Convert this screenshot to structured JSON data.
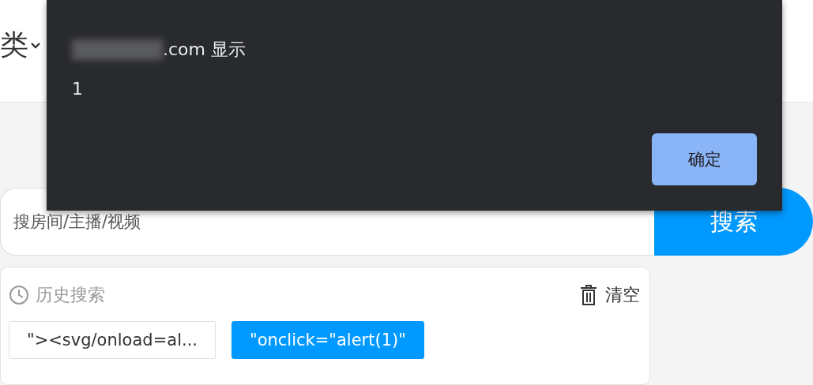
{
  "header": {
    "category_label": "类"
  },
  "search": {
    "placeholder": "搜房间/主播/视频",
    "button": "搜索"
  },
  "history": {
    "title": "历史搜索",
    "clear": "清空",
    "tags": [
      {
        "label": "\"><svg/onload=al...",
        "selected": false
      },
      {
        "label": "\"onclick=\"alert(1)\"",
        "selected": true
      }
    ]
  },
  "dialog": {
    "title": ".com 显示",
    "message": "1",
    "button": "确定"
  }
}
